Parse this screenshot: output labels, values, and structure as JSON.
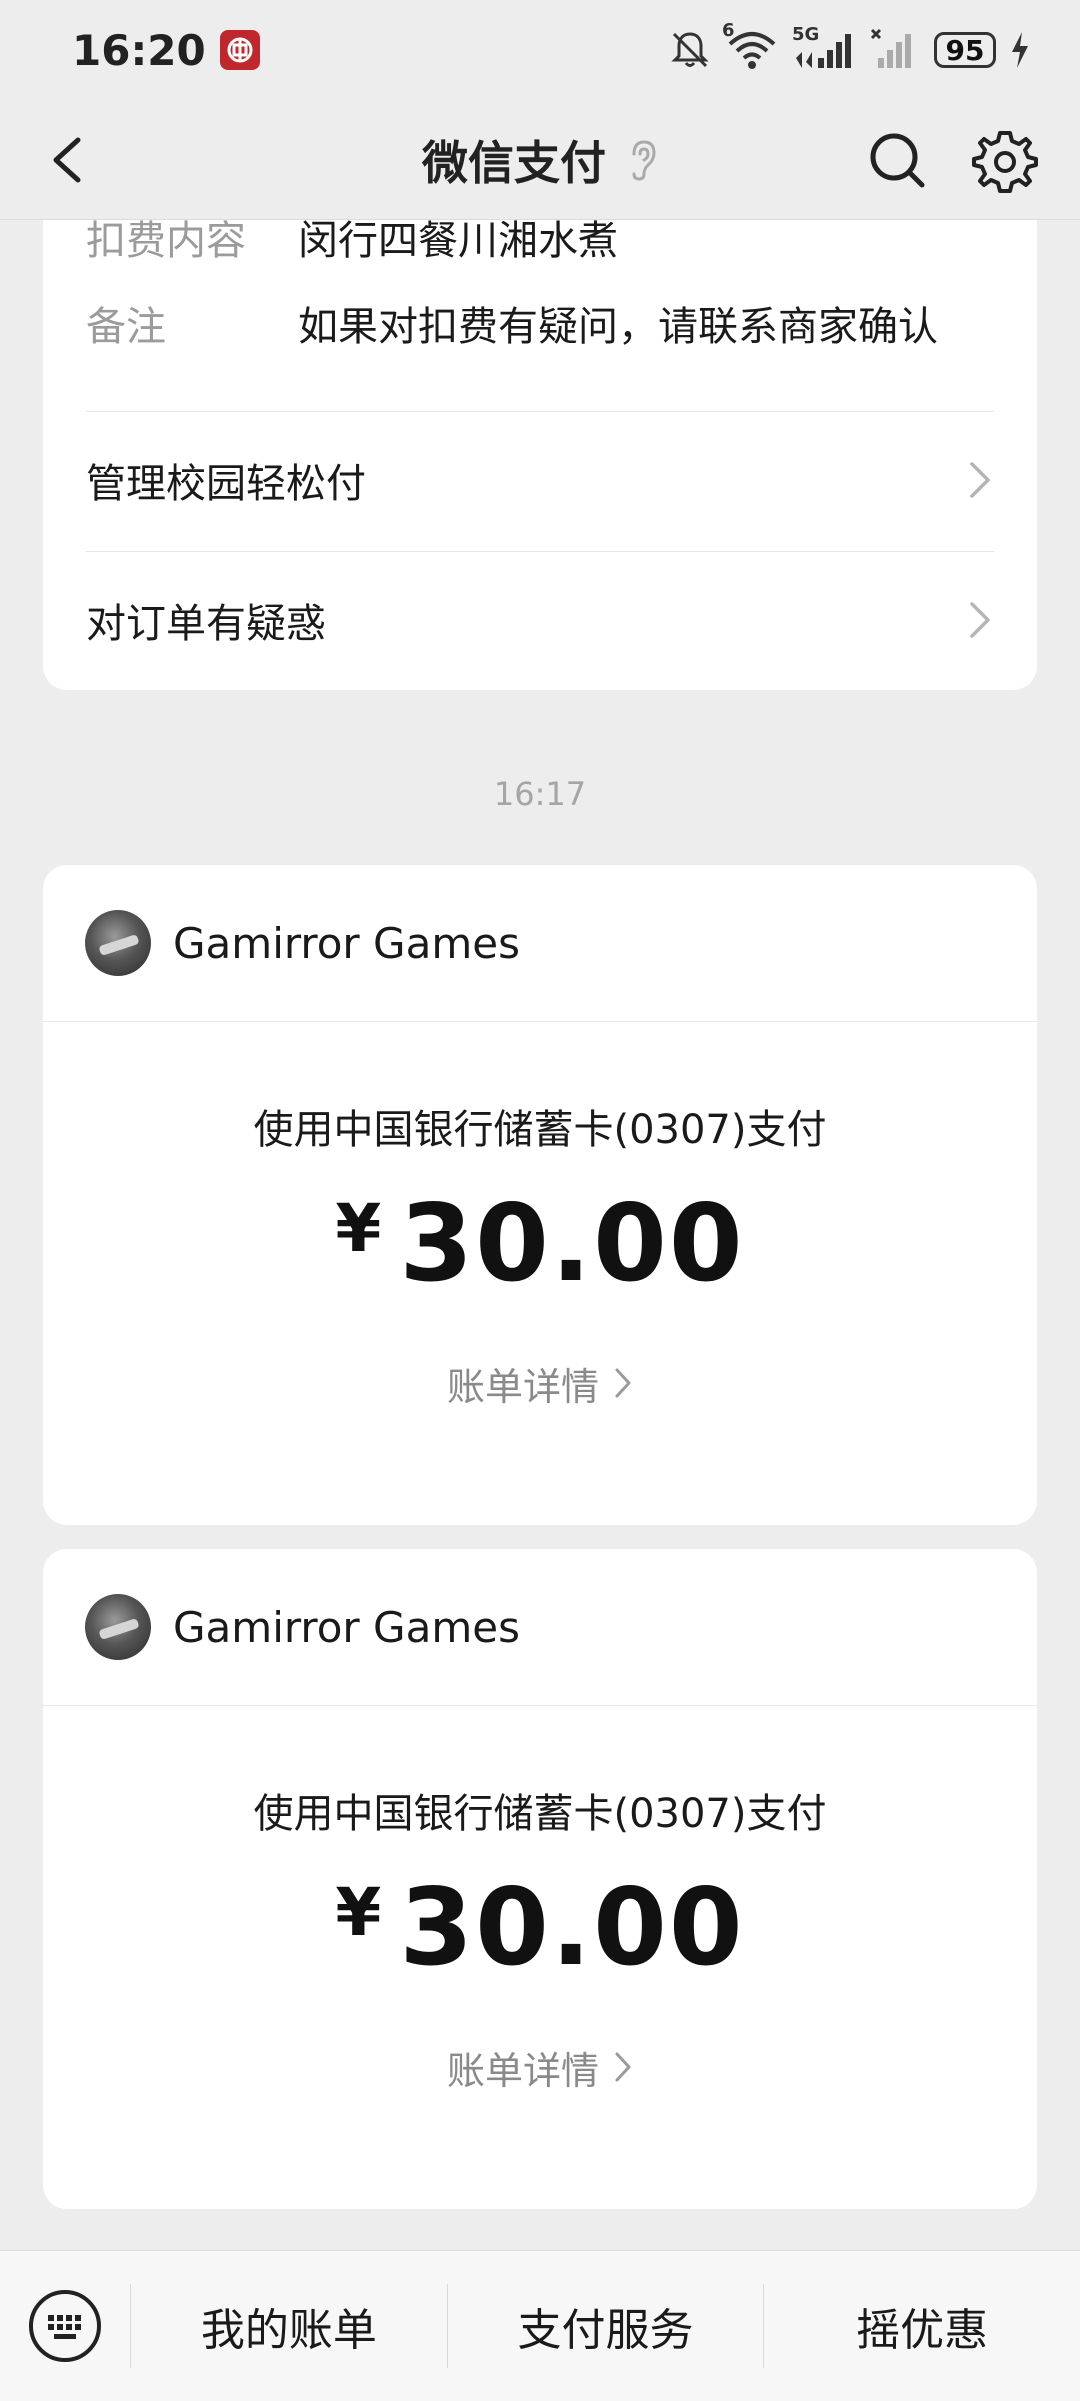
{
  "status_bar": {
    "time": "16:20",
    "battery": "95",
    "network_label": "5G",
    "wifi_label": "6",
    "icons": [
      "bank-of-china-icon",
      "mute-icon",
      "wifi-icon",
      "signal-icon",
      "no-signal-icon",
      "battery-icon",
      "charging-icon"
    ]
  },
  "nav": {
    "title": "微信支付",
    "icons": [
      "back-icon",
      "ear-icon",
      "search-icon",
      "gear-icon"
    ]
  },
  "top_card": {
    "rows": [
      {
        "key": "扣费内容",
        "value": "闵行四餐川湘水煮"
      },
      {
        "key": "备注",
        "value": "如果对扣费有疑问，请联系商家确认"
      }
    ],
    "links": [
      {
        "label": "管理校园轻松付"
      },
      {
        "label": "对订单有疑惑"
      }
    ]
  },
  "timestamp": "16:17",
  "payments": [
    {
      "merchant": "Gamirror Games",
      "method": "使用中国银行储蓄卡(0307)支付",
      "currency": "¥",
      "amount": "30.00",
      "detail_label": "账单详情"
    },
    {
      "merchant": "Gamirror Games",
      "method": "使用中国银行储蓄卡(0307)支付",
      "currency": "¥",
      "amount": "30.00",
      "detail_label": "账单详情"
    }
  ],
  "bottom_bar": {
    "tabs": [
      {
        "label": "我的账单"
      },
      {
        "label": "支付服务"
      },
      {
        "label": "摇优惠"
      }
    ]
  }
}
